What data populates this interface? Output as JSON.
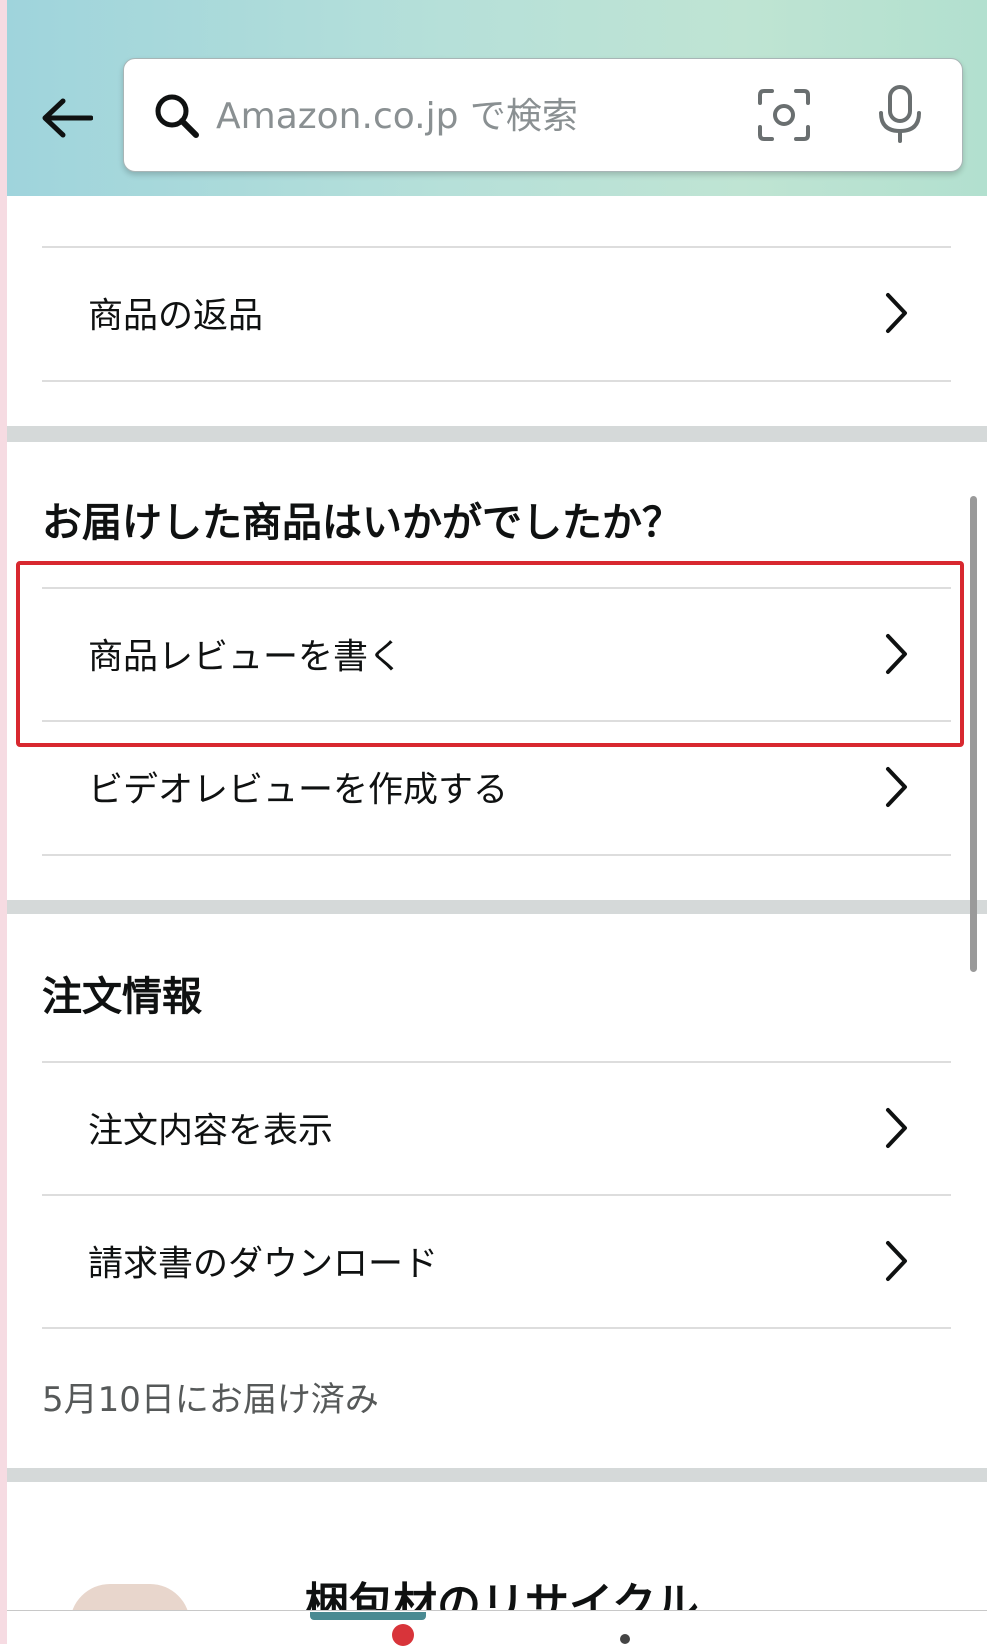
{
  "search": {
    "placeholder": "Amazon.co.jp で検索"
  },
  "returns_section": {
    "items": [
      {
        "label": "商品の返品"
      }
    ]
  },
  "review_section": {
    "title": "お届けした商品はいかがでしたか？",
    "items": [
      {
        "label": "商品レビューを書く",
        "highlighted": true
      },
      {
        "label": "ビデオレビューを作成する"
      }
    ]
  },
  "order_section": {
    "title": "注文情報",
    "items": [
      {
        "label": "注文内容を表示"
      },
      {
        "label": "請求書のダウンロード"
      }
    ],
    "delivery_status": "5月10日にお届け済み"
  },
  "recycle_section": {
    "title": "梱包材のリサイクル"
  },
  "colors": {
    "highlight": "#d8282f",
    "header_start": "#9fd4dc",
    "header_end": "#b2e0cf",
    "cart_badge": "#d8343a"
  },
  "icons": {
    "back": "arrow-left-icon",
    "search": "search-icon",
    "camera": "camera-icon",
    "mic": "microphone-icon",
    "row": "chevron-right-icon"
  }
}
